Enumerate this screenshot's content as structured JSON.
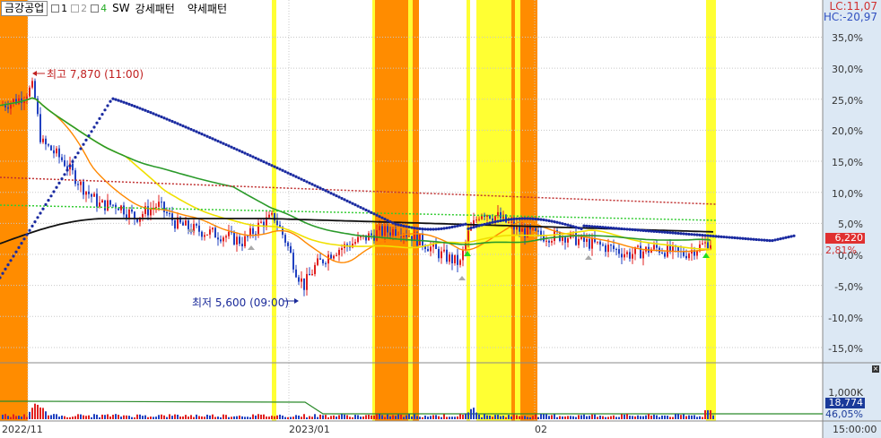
{
  "header": {
    "stock_name": "금강공업",
    "tabs": [
      {
        "label": "1",
        "color": "#333333"
      },
      {
        "label": "2",
        "color": "#999999"
      },
      {
        "label": "4",
        "color": "#22aa22"
      }
    ],
    "pattern_labels": [
      "SW",
      "강세패턴",
      "약세패턴"
    ]
  },
  "corner": {
    "lc": "LC:11,07",
    "hc": "HC:-20,97"
  },
  "annotations": {
    "high": "최고 7,870 (11:00)",
    "low": "최저 5,600 (09:00)"
  },
  "y_axis": [
    "35,0%",
    "30,0%",
    "25,0%",
    "20,0%",
    "15,0%",
    "10,0%",
    "5,0%",
    "0,0%",
    "-5,0%",
    "-10,0%",
    "-15,0%"
  ],
  "current": {
    "price": "6,220",
    "pct": "2,81%"
  },
  "volume_panel": {
    "tick": "1,000K",
    "current": "18,774",
    "pct": "46,05%"
  },
  "x_axis": [
    "2022/11",
    "2023/01",
    "02",
    "15:00:00"
  ],
  "colors": {
    "strong": "#ff8c00",
    "weak": "#ffff33",
    "up": "#e02020",
    "down": "#2040c0",
    "ma_blue": "#1a2aa0",
    "ma_black": "#111111"
  }
}
